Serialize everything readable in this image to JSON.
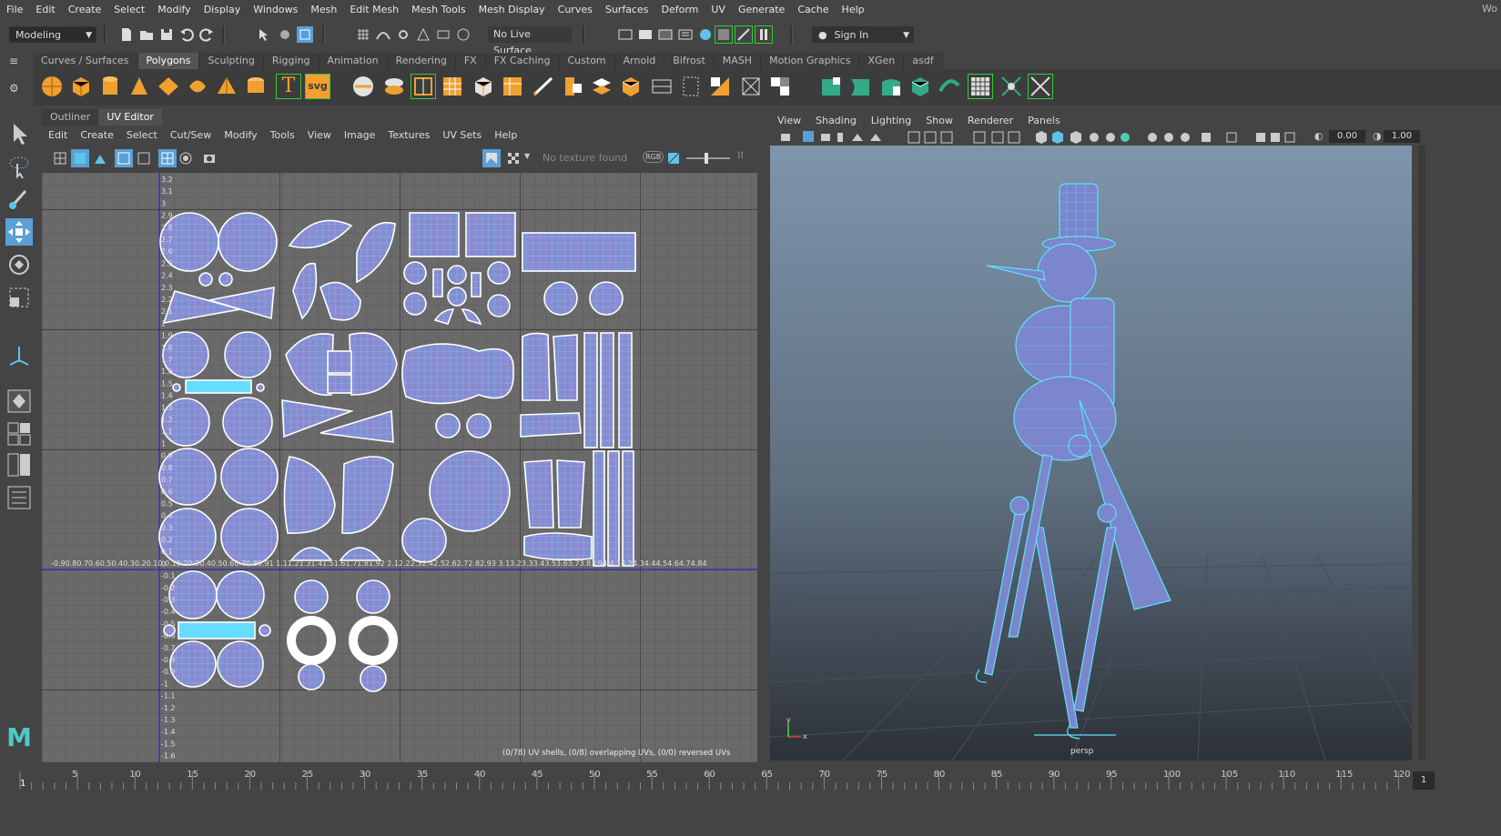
{
  "menubar": {
    "items": [
      "File",
      "Edit",
      "Create",
      "Select",
      "Modify",
      "Display",
      "Windows",
      "Mesh",
      "Edit Mesh",
      "Mesh Tools",
      "Mesh Display",
      "Curves",
      "Surfaces",
      "Deform",
      "UV",
      "Generate",
      "Cache",
      "Help"
    ],
    "workspace_clip": "Wo"
  },
  "statusline": {
    "mode": "Modeling",
    "live_surface": "No Live Surface",
    "sign_in": "Sign In"
  },
  "shelf": {
    "tabs": [
      "Curves / Surfaces",
      "Polygons",
      "Sculpting",
      "Rigging",
      "Animation",
      "Rendering",
      "FX",
      "FX Caching",
      "Custom",
      "Arnold",
      "Bifrost",
      "MASH",
      "Motion Graphics",
      "XGen",
      "asdf"
    ],
    "active_tab": "Polygons",
    "text_tool_label": "T",
    "svg_tool_label": "svg"
  },
  "uv": {
    "tabs": [
      "Outliner",
      "UV Editor"
    ],
    "active_tab": "UV Editor",
    "menu": [
      "Edit",
      "Create",
      "Select",
      "Cut/Sew",
      "Modify",
      "Tools",
      "View",
      "Image",
      "Textures",
      "UV Sets",
      "Help"
    ],
    "texture_status": "No texture found",
    "rgb_label": "RGB",
    "shell_info": "(0/78) UV shells, (0/8) overlapping UVs, (0/0) reversed UVs",
    "v_ticks": [
      "3.2",
      "3.1",
      "3",
      "2.9",
      "2.8",
      "2.7",
      "2.6",
      "2.5",
      "2.4",
      "2.3",
      "2.2",
      "2.1",
      "2",
      "1.9",
      "1.8",
      "1.7",
      "1.6",
      "1.5",
      "1.4",
      "1.3",
      "1.2",
      "1.1",
      "1",
      "0.9",
      "0.8",
      "0.7",
      "0.6",
      "0.5",
      "0.4",
      "0.3",
      "0.2",
      "0.1",
      "0",
      "-0.1",
      "-0.2",
      "-0.3",
      "-0.4",
      "-0.5",
      "-0.6",
      "-0.7",
      "-0.8",
      "-0.9",
      "-1",
      "-1.1",
      "-1.2",
      "-1.3",
      "-1.4",
      "-1.5",
      "-1.6"
    ],
    "u_ticks": "-0.90.80.70.60.50.40.30.20.10  0.10.20.30.40.50.60.70.80.91  1.11.21.31.41.51.61.71.81.92  2.12.22.32.42.52.62.72.82.93  3.13.23.33.43.53.63.73.83.94  4.14.24.34.44.54.64.74.84"
  },
  "viewport": {
    "menu": [
      "View",
      "Shading",
      "Lighting",
      "Show",
      "Renderer",
      "Panels"
    ],
    "near_value": "0.00",
    "far_value": "1.00",
    "camera": "persp",
    "axis_x": "x",
    "axis_y": "y"
  },
  "timeline": {
    "ticks": [
      "5",
      "10",
      "15",
      "20",
      "25",
      "30",
      "35",
      "40",
      "45",
      "50",
      "55",
      "60",
      "65",
      "70",
      "75",
      "80",
      "85",
      "90",
      "95",
      "100",
      "105",
      "110",
      "115",
      "120"
    ],
    "current_frame": "1",
    "end_frame": "1"
  },
  "colors": {
    "accent": "#5fc2e8",
    "uv_shell_fill": "#8a8ad0",
    "uv_line": "#3fd4ff",
    "grid_bg": "#6a6a6a",
    "active_blue": "#5aa0d6"
  }
}
